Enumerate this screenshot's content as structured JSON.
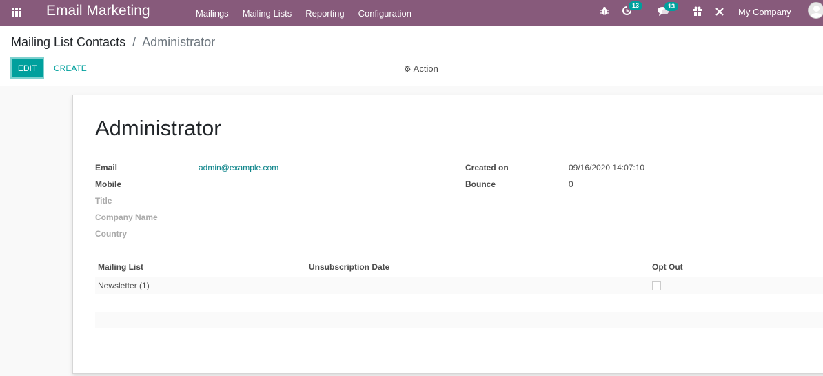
{
  "navbar": {
    "app_title": "Email Marketing",
    "menu": [
      "Mailings",
      "Mailing Lists",
      "Reporting",
      "Configuration"
    ],
    "systray": {
      "activity_count": "13",
      "messages_count": "13",
      "company": "My Company"
    },
    "colors": {
      "navbar_bg": "#875a7b",
      "badge_bg": "#00a09d"
    }
  },
  "control_panel": {
    "breadcrumb": {
      "parent": "Mailing List Contacts",
      "separator": "/",
      "current": "Administrator"
    },
    "edit_label": "EDIT",
    "create_label": "CREATE",
    "action_label": "Action",
    "accent_color": "#00a09d"
  },
  "record": {
    "name": "Administrator",
    "left_fields": [
      {
        "label": "Email",
        "value": "admin@example.com"
      },
      {
        "label": "Mobile",
        "value": ""
      },
      {
        "label": "Title",
        "value": ""
      },
      {
        "label": "Company Name",
        "value": ""
      },
      {
        "label": "Country",
        "value": ""
      }
    ],
    "right_fields": [
      {
        "label": "Created on",
        "value": "09/16/2020 14:07:10"
      },
      {
        "label": "Bounce",
        "value": "0"
      }
    ],
    "subscriptions": {
      "columns": [
        "Mailing List",
        "Unsubscription Date",
        "Opt Out"
      ],
      "rows": [
        {
          "mailing_list": "Newsletter (1)",
          "unsubscription_date": "",
          "opt_out": false
        }
      ]
    }
  }
}
